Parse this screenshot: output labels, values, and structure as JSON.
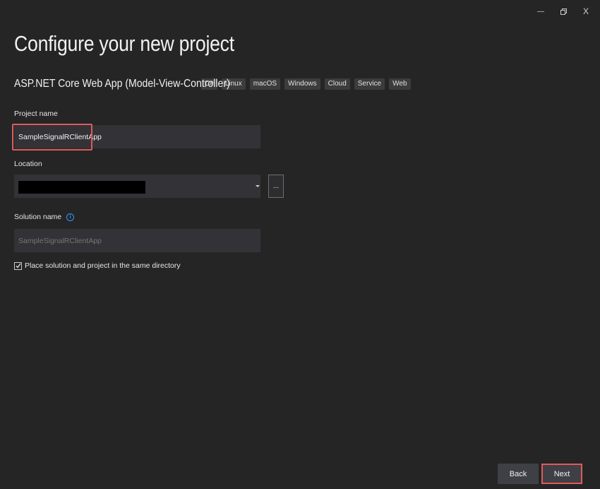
{
  "window": {
    "minimize_label": "—",
    "close_label": "X"
  },
  "header": {
    "title": "Configure your new project",
    "template_name": "ASP.NET Core Web App (Model-View-Controller)",
    "tags": [
      "C#",
      "Linux",
      "macOS",
      "Windows",
      "Cloud",
      "Service",
      "Web"
    ]
  },
  "form": {
    "project_name_label": "Project name",
    "project_name_value": "SampleSignalRClientApp",
    "location_label": "Location",
    "browse_label": "...",
    "solution_name_label": "Solution name",
    "info_icon_glyph": "i",
    "solution_name_placeholder": "SampleSignalRClientApp",
    "same_directory_label": "Place solution and project in the same directory",
    "same_directory_checked": true
  },
  "footer": {
    "back_label": "Back",
    "next_label": "Next"
  },
  "colors": {
    "background": "#252526",
    "input_background": "#333337",
    "highlight": "#e05a5a",
    "info_accent": "#3794ff"
  }
}
